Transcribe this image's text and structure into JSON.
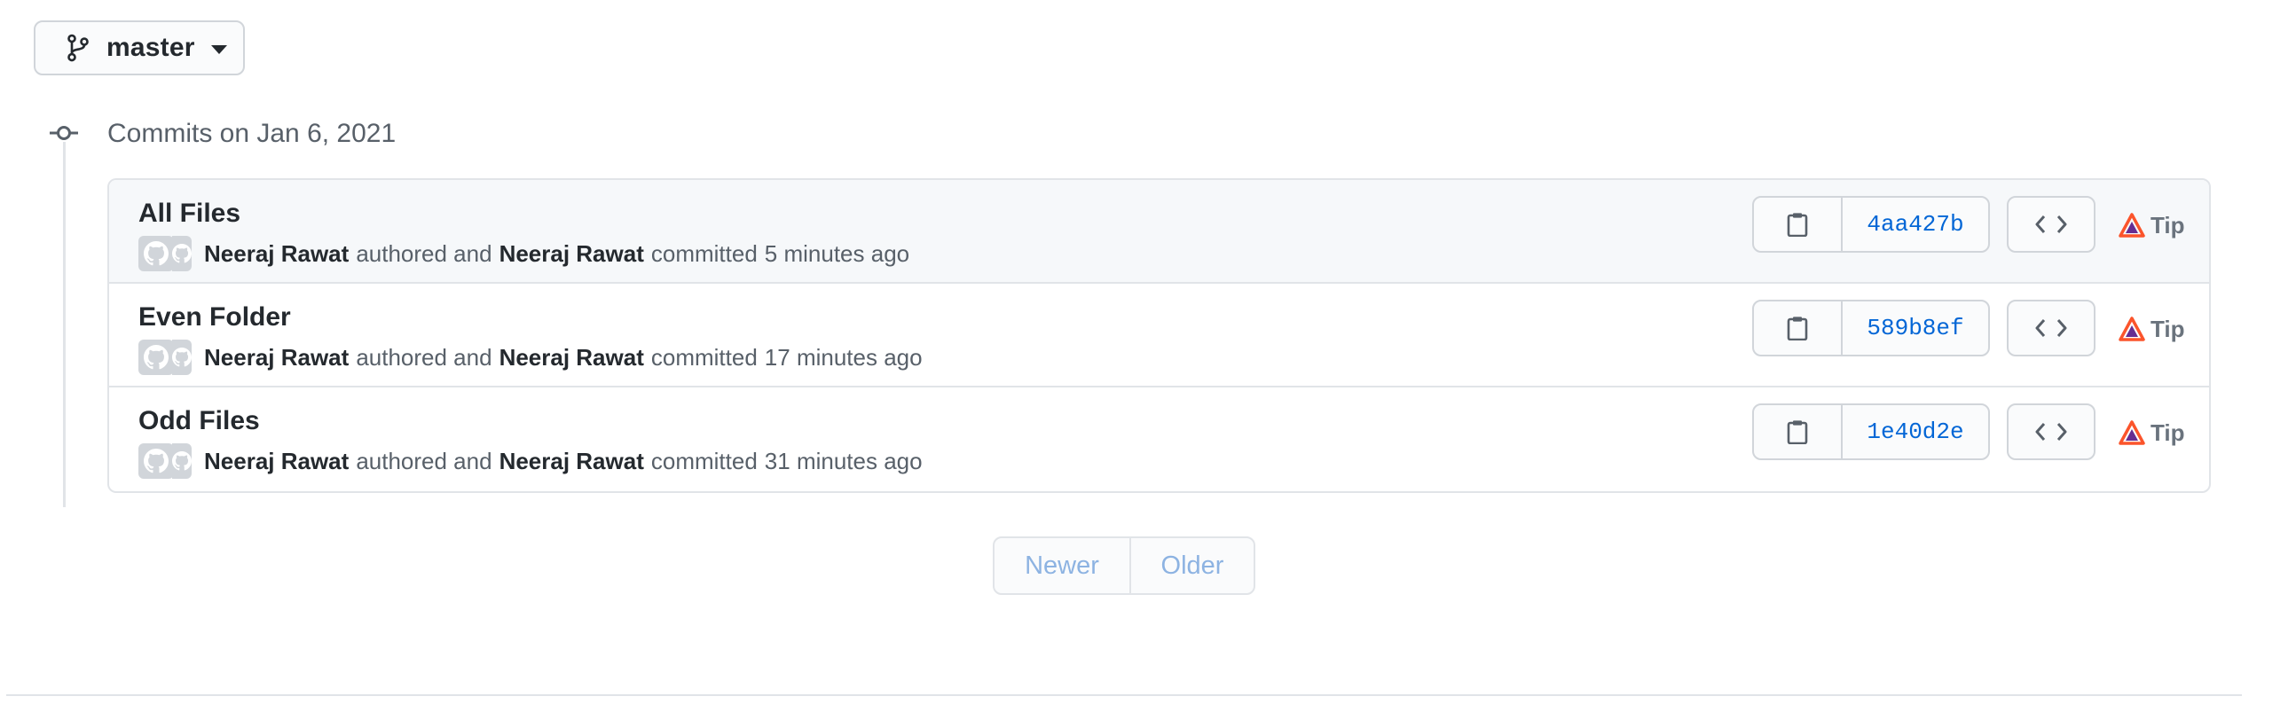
{
  "branch": {
    "name": "master",
    "icon": "git-branch-icon",
    "caret_icon": "triangle-down-icon"
  },
  "commit_group": {
    "title": "Commits on Jan 6, 2021",
    "icon": "git-commit-icon"
  },
  "commits": [
    {
      "title": "All Files",
      "author": "Neeraj Rawat",
      "authored_text": "authored and",
      "committer": "Neeraj Rawat",
      "committed_text": "committed",
      "time": "5 minutes ago",
      "sha": "4aa427b",
      "tip_label": "Tip"
    },
    {
      "title": "Even Folder",
      "author": "Neeraj Rawat",
      "authored_text": "authored and",
      "committer": "Neeraj Rawat",
      "committed_text": "committed",
      "time": "17 minutes ago",
      "sha": "589b8ef",
      "tip_label": "Tip"
    },
    {
      "title": "Odd Files",
      "author": "Neeraj Rawat",
      "authored_text": "authored and",
      "committer": "Neeraj Rawat",
      "committed_text": "committed",
      "time": "31 minutes ago",
      "sha": "1e40d2e",
      "tip_label": "Tip"
    }
  ],
  "pagination": {
    "newer_label": "Newer",
    "older_label": "Older"
  },
  "colors": {
    "link_blue": "#0366d6",
    "muted_text": "#586069",
    "border": "#e1e4e8",
    "disabled_blue": "#8db3e2",
    "brave_orange": "#fb542b",
    "brave_purple": "#662d91"
  }
}
